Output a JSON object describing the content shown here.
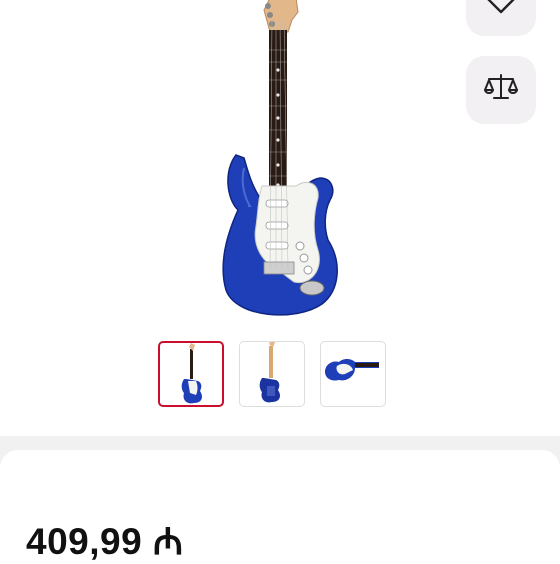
{
  "product": {
    "price": "409,99 ₼",
    "gallery": {
      "selected_index": 0,
      "thumbnails": [
        "guitar-front",
        "guitar-back",
        "guitar-side"
      ]
    }
  },
  "actions": {
    "wishlist_icon": "heart-icon",
    "compare_icon": "scales-icon"
  },
  "colors": {
    "accent": "#c8102e",
    "guitar_body": "#1f3fb8",
    "button_bg": "#f3f0f3"
  }
}
